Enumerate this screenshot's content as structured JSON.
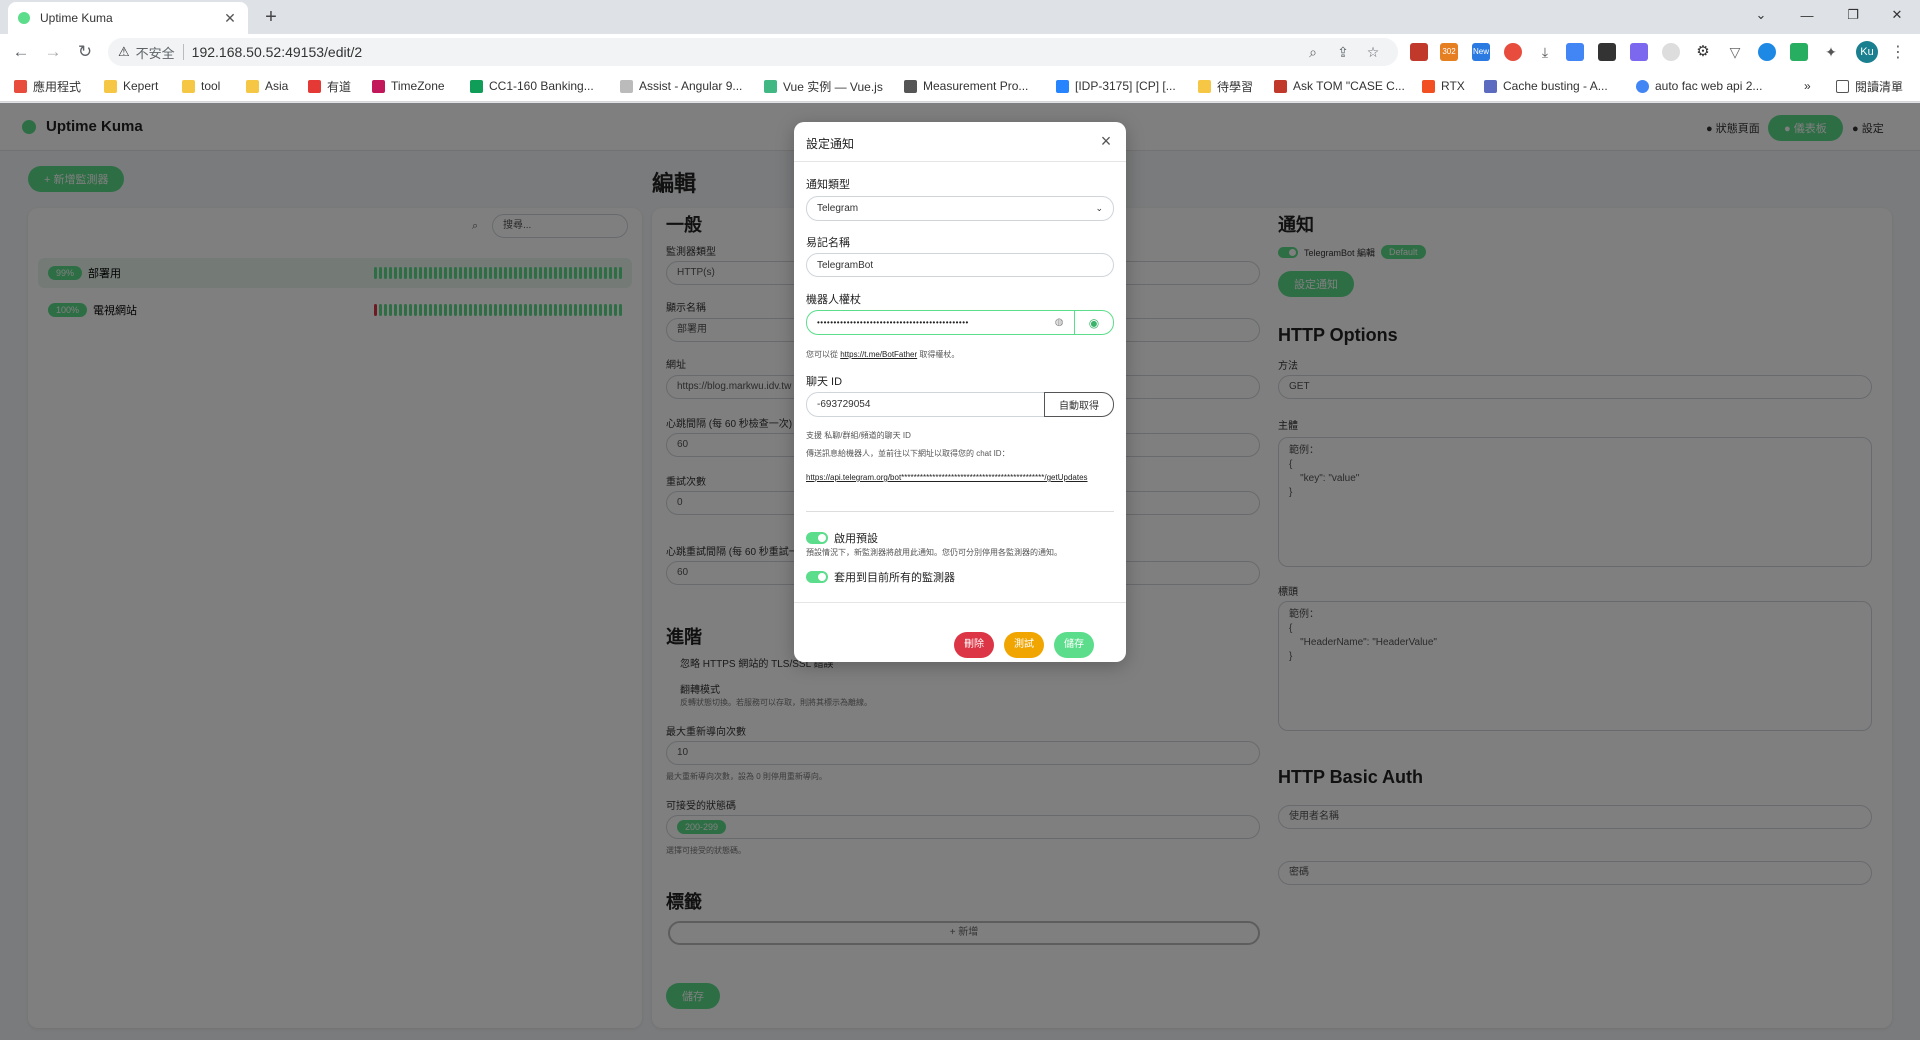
{
  "browser": {
    "tab_title": "Uptime Kuma",
    "tab_close": "✕",
    "new_tab": "+",
    "window_controls": [
      "⌄",
      "—",
      "❐",
      "✕"
    ],
    "security_icon": "⚠",
    "security_label": "不安全",
    "url": "192.168.50.52:49153/edit/2",
    "ext_badges": [
      "302",
      "New"
    ],
    "profile_initials": "Ku",
    "bookmarks": [
      "應用程式",
      "Kepert",
      "tool",
      "Asia",
      "有道",
      "TimeZone",
      "CC1-160 Banking...",
      "Assist - Angular 9...",
      "Vue 实例 — Vue.js",
      "Measurement Pro...",
      "[IDP-3175] [CP] [...",
      "待學習",
      "Ask TOM \"CASE C...",
      "RTX",
      "Cache busting - A...",
      "auto fac web api 2..."
    ],
    "bookmarks_more": "»",
    "reading_list": "閱讀清單"
  },
  "app": {
    "brand": "Uptime Kuma",
    "header_status": "● 狀態頁面",
    "header_dashboard": "● 儀表板",
    "header_settings": "● 設定",
    "add_monitor": "+ 新增監測器",
    "search_placeholder": "搜尋...",
    "monitors": [
      {
        "status": "99%",
        "name": "部署用"
      },
      {
        "status": "100%",
        "name": "電視網站"
      }
    ],
    "edit_title": "編輯",
    "general_title": "一般",
    "fields": [
      {
        "label": "監測器類型",
        "value": "HTTP(s)"
      },
      {
        "label": "顯示名稱",
        "value": "部署用"
      },
      {
        "label": "網址",
        "value": "https://blog.markwu.idv.tw"
      },
      {
        "label": "心跳間隔 (每 60 秒檢查一次)",
        "value": "60"
      },
      {
        "label": "重試次數",
        "value": "0"
      },
      {
        "label": "心跳重試間隔 (每 60 秒重試一次)",
        "value": "60"
      }
    ],
    "advanced_title": "進階",
    "advanced_opt1": "忽略 HTTPS 網站的 TLS/SSL 錯誤",
    "advanced_opt2": "翻轉模式",
    "advanced_opt2_help": "反轉狀態切換。若服務可以存取，則將其標示為離線。",
    "max_redirects_label": "最大重新導向次數",
    "max_redirects_value": "10",
    "max_redirects_help": "最大重新導向次數，設為 0 則停用重新導向。",
    "accepted_codes_label": "可接受的狀態碼",
    "accepted_codes_value": "200-299",
    "accepted_codes_help": "選擇可接受的狀態碼。",
    "tags_title": "標籤",
    "add_tag": "+ 新增",
    "save": "儲存",
    "notifications_title": "通知",
    "notification_item": "TelegramBot 編輯",
    "notification_default": "Default",
    "setup_notification": "設定通知",
    "http_options_title": "HTTP Options",
    "method_label": "方法",
    "method_value": "GET",
    "body_label": "主體",
    "body_placeholder": "範例：\n{\n    \"key\": \"value\"\n}",
    "headers_label": "標頭",
    "headers_placeholder": "範例：\n{\n    \"HeaderName\": \"HeaderValue\"\n}",
    "basic_auth_title": "HTTP Basic Auth",
    "username_placeholder": "使用者名稱",
    "password_placeholder": "密碼"
  },
  "modal": {
    "title": "設定通知",
    "close_icon": "×",
    "type_label": "通知類型",
    "type_value": "Telegram",
    "type_chevron": "⌄",
    "friendly_name_label": "易記名稱",
    "friendly_name_value": "TelegramBot",
    "bot_token_label": "機器人權杖",
    "bot_token_value": "••••••••••••••••••••••••••••••••••••••••••••••",
    "eye_icon": "👁",
    "token_help_prefix": "您可以從",
    "token_help_link": "https://t.me/BotFather",
    "token_help_suffix": "取得權杖。",
    "chat_id_label": "聊天 ID",
    "chat_id_value": "-693729054",
    "auto_get_button": "自動取得",
    "chat_help_1": "支援 私聊/群組/頻道的聊天 ID",
    "chat_help_2": "傳送訊息給機器人，並前往以下網址以取得您的 chat ID：",
    "get_updates_link": "https://api.telegram.org/bot**********************************************/getUpdates",
    "default_enabled_label": "啟用預設",
    "default_enabled_help": "預設情況下，新監測器將啟用此通知。您仍可分別停用各監測器的通知。",
    "apply_existing_label": "套用到目前所有的監測器",
    "delete_button": "刪除",
    "test_button": "測試",
    "save_button": "儲存"
  },
  "colors": {
    "accent": "#5cdd8b",
    "danger": "#dc3545",
    "warning": "#f0a500"
  }
}
